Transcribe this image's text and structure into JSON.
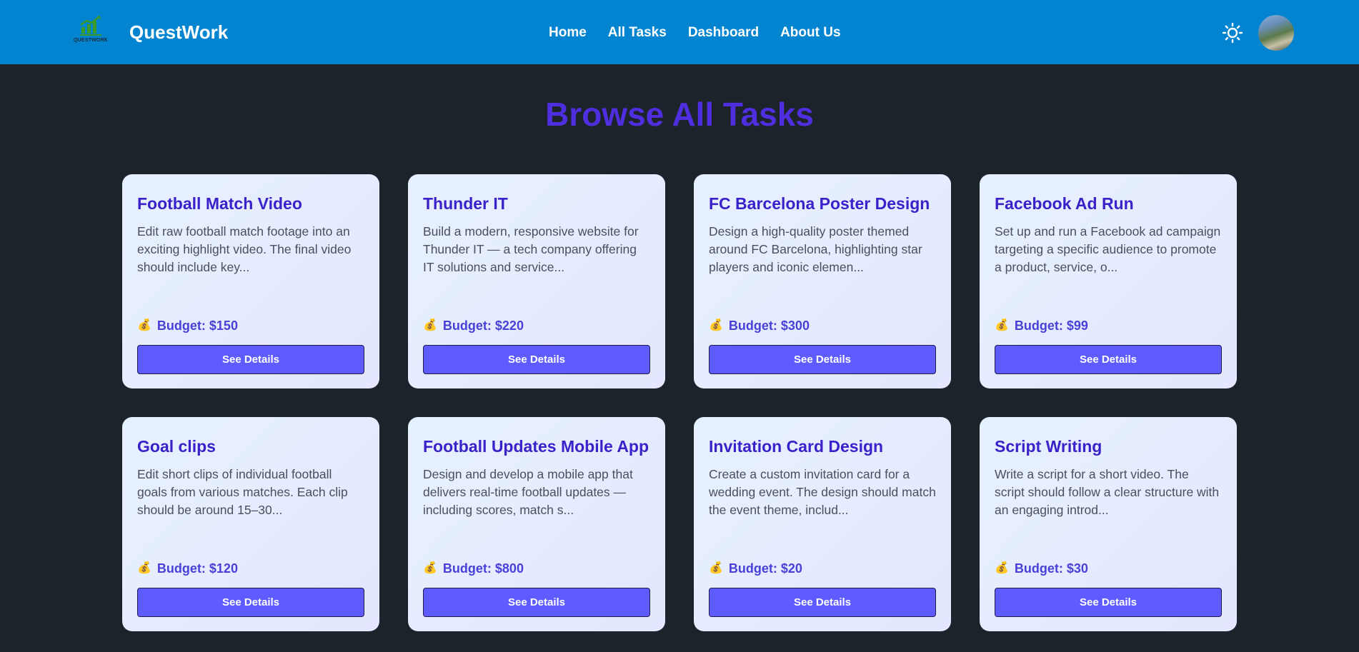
{
  "header": {
    "logo_text": "QUESTWORK",
    "brand": "QuestWork",
    "nav": [
      "Home",
      "All Tasks",
      "Dashboard",
      "About Us"
    ],
    "theme_icon": "sun-icon",
    "avatar_icon": "user-avatar"
  },
  "main": {
    "title": "Browse All Tasks",
    "budget_icon": "money-bag-icon",
    "tasks": [
      {
        "title": "Football Match Video",
        "description": "Edit raw football match footage into an exciting highlight video. The final video should include key...",
        "budget": "Budget: $150",
        "button": "See Details"
      },
      {
        "title": "Thunder IT",
        "description": "Build a modern, responsive website for Thunder IT — a tech company offering IT solutions and service...",
        "budget": "Budget: $220",
        "button": "See Details"
      },
      {
        "title": "FC Barcelona Poster Design",
        "description": "Design a high-quality poster themed around FC Barcelona, highlighting star players and iconic elemen...",
        "budget": "Budget: $300",
        "button": "See Details"
      },
      {
        "title": "Facebook Ad Run",
        "description": "Set up and run a Facebook ad campaign targeting a specific audience to promote a product, service, o...",
        "budget": "Budget: $99",
        "button": "See Details"
      },
      {
        "title": "Goal clips",
        "description": "Edit short clips of individual football goals from various matches. Each clip should be around 15–30...",
        "budget": "Budget: $120",
        "button": "See Details"
      },
      {
        "title": "Football Updates Mobile App",
        "description": "Design and develop a mobile app that delivers real-time football updates — including scores, match s...",
        "budget": "Budget: $800",
        "button": "See Details"
      },
      {
        "title": "Invitation Card Design",
        "description": "Create a custom invitation card for a wedding event. The design should match the event theme, includ...",
        "budget": "Budget: $20",
        "button": "See Details"
      },
      {
        "title": "Script Writing",
        "description": "Write a script for a short video. The script should follow a clear structure with an engaging introd...",
        "budget": "Budget: $30",
        "button": "See Details"
      }
    ]
  },
  "colors": {
    "navbar": "#0284d0",
    "background": "#1d232a",
    "title": "#4f2ee0",
    "button": "#5e5cff"
  }
}
